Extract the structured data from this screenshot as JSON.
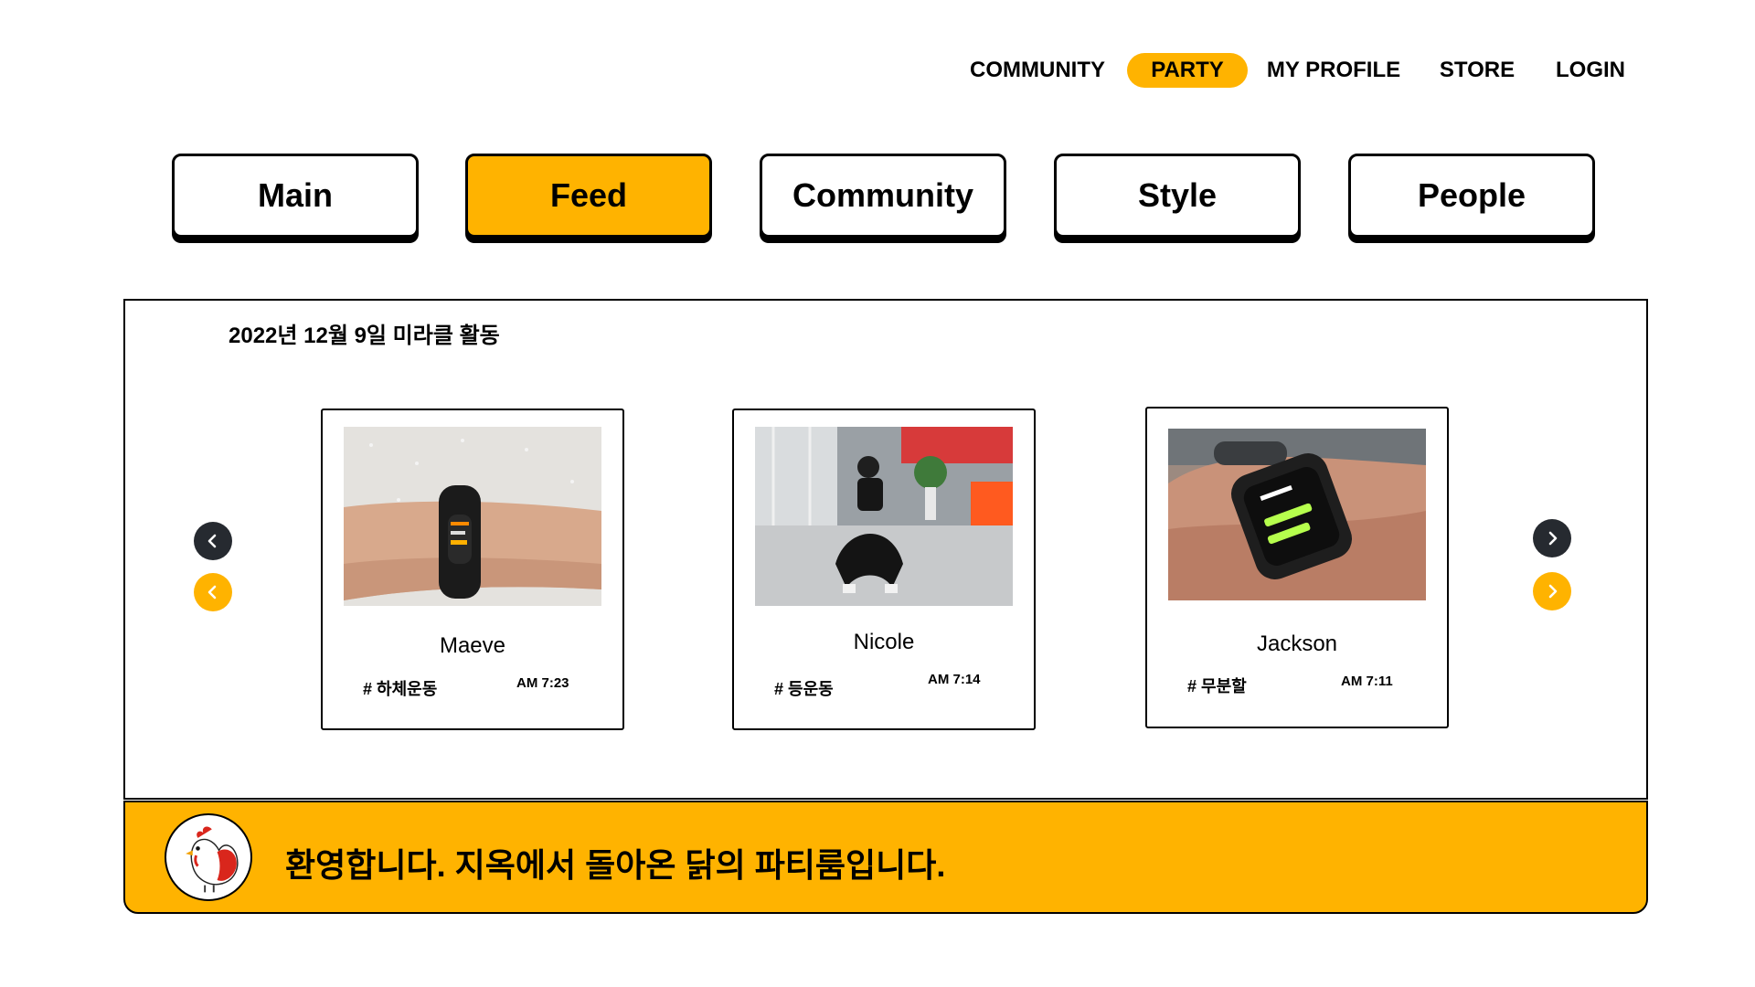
{
  "topnav": {
    "items": [
      {
        "label": "COMMUNITY",
        "active": false
      },
      {
        "label": "PARTY",
        "active": true
      },
      {
        "label": "MY PROFILE",
        "active": false
      },
      {
        "label": "STORE",
        "active": false
      },
      {
        "label": "LOGIN",
        "active": false
      }
    ]
  },
  "tabs": [
    {
      "label": "Main",
      "active": false
    },
    {
      "label": "Feed",
      "active": true
    },
    {
      "label": "Community",
      "active": false
    },
    {
      "label": "Style",
      "active": false
    },
    {
      "label": "People",
      "active": false
    }
  ],
  "feed": {
    "title": "2022년  12월 9일 미라클 활동",
    "cards": [
      {
        "name": "Maeve",
        "tag": "# 하체운동",
        "time": "AM 7:23"
      },
      {
        "name": "Nicole",
        "tag": "# 등운동",
        "time": "AM 7:14"
      },
      {
        "name": "Jackson",
        "tag": "# 무분할",
        "time": "AM 7:11"
      }
    ]
  },
  "banner": {
    "text": "환영합니다. 지옥에서 돌아온 닭의 파티룸입니다."
  },
  "colors": {
    "accent": "#ffb300",
    "arrow_dark": "#262a30"
  }
}
